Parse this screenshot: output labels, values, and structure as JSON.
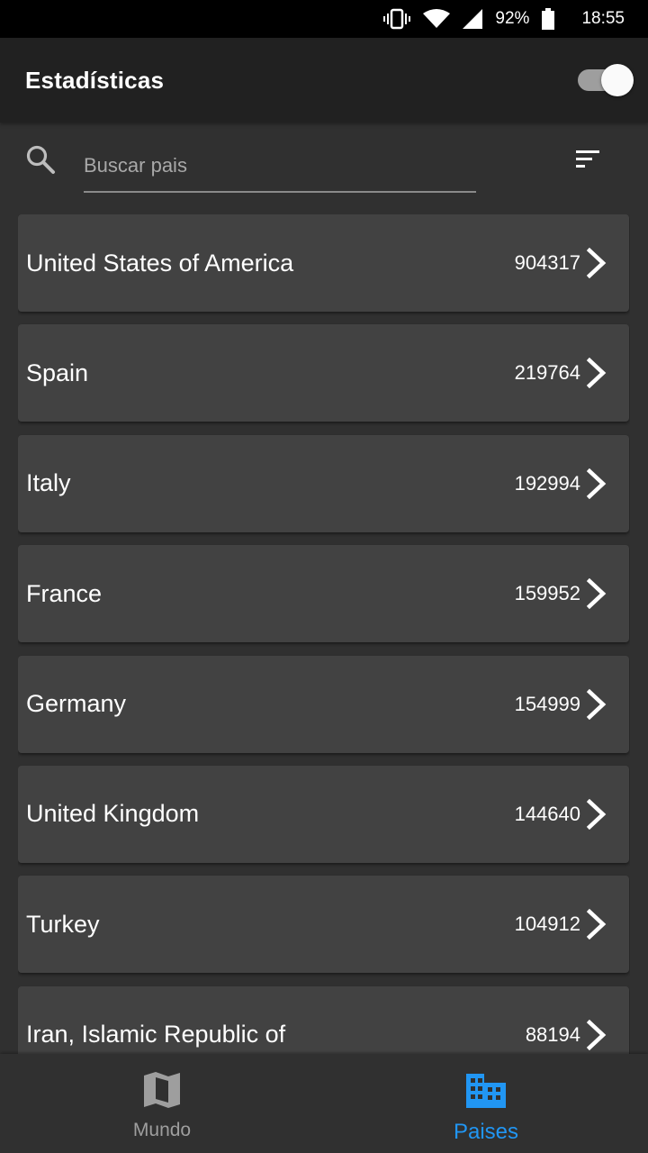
{
  "status_bar": {
    "battery_percent": "92%",
    "time": "18:55",
    "icons": [
      "vibrate-icon",
      "wifi-icon",
      "signal-icon",
      "battery-icon"
    ]
  },
  "app_bar": {
    "title": "Estadísticas",
    "dark_mode_toggle_on": true
  },
  "search": {
    "placeholder": "Buscar pais",
    "value": ""
  },
  "countries": [
    {
      "name": "United States of America",
      "count": "904317"
    },
    {
      "name": "Spain",
      "count": "219764"
    },
    {
      "name": "Italy",
      "count": "192994"
    },
    {
      "name": "France",
      "count": "159952"
    },
    {
      "name": "Germany",
      "count": "154999"
    },
    {
      "name": "United Kingdom",
      "count": "144640"
    },
    {
      "name": "Turkey",
      "count": "104912"
    },
    {
      "name": "Iran, Islamic Republic of",
      "count": "88194"
    }
  ],
  "bottom_nav": {
    "items": [
      {
        "label": "Mundo",
        "icon": "map-icon",
        "active": false
      },
      {
        "label": "Paises",
        "icon": "city-icon",
        "active": true
      }
    ]
  },
  "colors": {
    "accent": "#2196f3",
    "background": "#303030",
    "card": "#424242",
    "app_bar": "#212121"
  }
}
